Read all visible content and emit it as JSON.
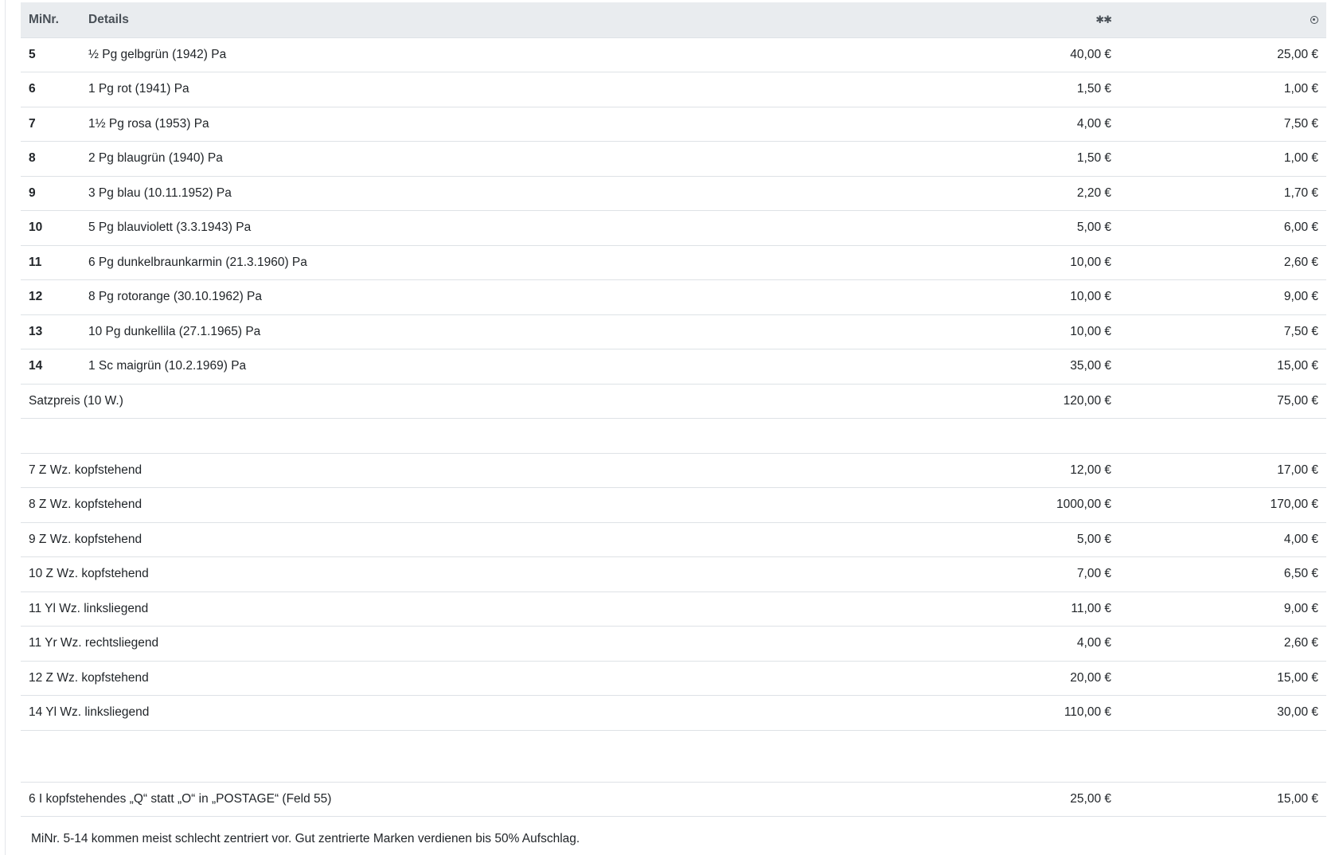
{
  "header": {
    "col_nr": "MiNr.",
    "col_details": "Details",
    "col_mint_symbol": "✱✱",
    "col_used_icon": "postmark-circle-icon"
  },
  "stamps": [
    {
      "nr": "5",
      "details": "½ Pg gelbgrün (1942) Pa",
      "mint": "40,00 €",
      "used": "25,00 €"
    },
    {
      "nr": "6",
      "details": "1 Pg rot (1941) Pa",
      "mint": "1,50 €",
      "used": "1,00 €"
    },
    {
      "nr": "7",
      "details": "1½ Pg rosa (1953) Pa",
      "mint": "4,00 €",
      "used": "7,50 €"
    },
    {
      "nr": "8",
      "details": "2 Pg blaugrün (1940) Pa",
      "mint": "1,50 €",
      "used": "1,00 €"
    },
    {
      "nr": "9",
      "details": "3 Pg blau (10.11.1952) Pa",
      "mint": "2,20 €",
      "used": "1,70 €"
    },
    {
      "nr": "10",
      "details": "5 Pg blauviolett (3.3.1943) Pa",
      "mint": "5,00 €",
      "used": "6,00 €"
    },
    {
      "nr": "11",
      "details": "6 Pg dunkelbraunkarmin (21.3.1960) Pa",
      "mint": "10,00 €",
      "used": "2,60 €"
    },
    {
      "nr": "12",
      "details": "8 Pg rotorange (30.10.1962) Pa",
      "mint": "10,00 €",
      "used": "9,00 €"
    },
    {
      "nr": "13",
      "details": "10 Pg dunkellila (27.1.1965) Pa",
      "mint": "10,00 €",
      "used": "7,50 €"
    },
    {
      "nr": "14",
      "details": "1 Sc maigrün (10.2.1969) Pa",
      "mint": "35,00 €",
      "used": "15,00 €"
    }
  ],
  "set_price": {
    "label": "Satzpreis (10 W.)",
    "mint": "120,00 €",
    "used": "75,00 €"
  },
  "watermark_variants": [
    {
      "label": "7 Z Wz. kopfstehend",
      "mint": "12,00 €",
      "used": "17,00 €"
    },
    {
      "label": "8 Z Wz. kopfstehend",
      "mint": "1000,00 €",
      "used": "170,00 €"
    },
    {
      "label": "9 Z Wz. kopfstehend",
      "mint": "5,00 €",
      "used": "4,00 €"
    },
    {
      "label": "10 Z Wz. kopfstehend",
      "mint": "7,00 €",
      "used": "6,50 €"
    },
    {
      "label": "11 Yl Wz. linksliegend",
      "mint": "11,00 €",
      "used": "9,00 €"
    },
    {
      "label": "11 Yr Wz. rechtsliegend",
      "mint": "4,00 €",
      "used": "2,60 €"
    },
    {
      "label": "12 Z Wz. kopfstehend",
      "mint": "20,00 €",
      "used": "15,00 €"
    },
    {
      "label": "14 Yl Wz. linksliegend",
      "mint": "110,00 €",
      "used": "30,00 €"
    }
  ],
  "plate_flaws": [
    {
      "label": "6 I kopfstehendes „Q“ statt „O“ in „POSTAGE“ (Feld 55)",
      "mint": "25,00 €",
      "used": "15,00 €"
    }
  ],
  "footnote": "MiNr. 5-14 kommen meist schlecht zentriert vor. Gut zentrierte Marken verdienen bis 50% Aufschlag."
}
